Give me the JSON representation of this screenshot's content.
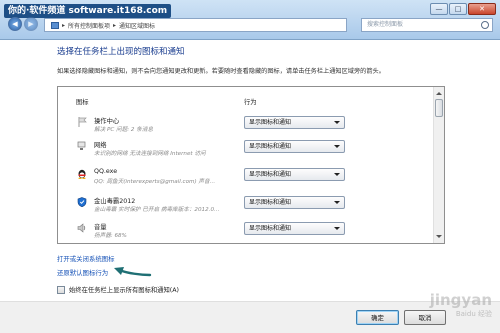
{
  "watermark": {
    "text": "你的·软件频道 software.it168.com"
  },
  "window": {
    "min_label": "—",
    "max_label": "□",
    "close_label": "✕"
  },
  "address": {
    "segments": [
      "所有控制面板项",
      "通知区域图标"
    ]
  },
  "search": {
    "placeholder": "搜索控制面板"
  },
  "page": {
    "title": "选择在任务栏上出现的图标和通知",
    "description": "如果选择隐藏图标和通知，则不会向您通知更改和更新。若要随时查看隐藏的图标，请单击任务栏上通知区域旁的箭头。"
  },
  "list": {
    "col_icon": "图标",
    "col_behavior": "行为",
    "rows": [
      {
        "name": "操作中心",
        "sub": "解决 PC 问题: 2 条消息",
        "behavior": "显示图标和通知",
        "icon": "flag-icon"
      },
      {
        "name": "网络",
        "sub": "未识别的网络 无法连接到网络 Internet 访问",
        "behavior": "显示图标和通知",
        "icon": "network-icon"
      },
      {
        "name": "QQ.exe",
        "sub": "QQ: 周鱼天(interexperts@gmail.com) 声音…",
        "behavior": "显示图标和通知",
        "icon": "qq-icon"
      },
      {
        "name": "金山毒霸2012",
        "sub": "金山毒霸 实时保护 已开启 病毒库版本：2012.0…",
        "behavior": "显示图标和通知",
        "icon": "shield-icon"
      },
      {
        "name": "音量",
        "sub": "扬声器: 68%",
        "behavior": "显示图标和通知",
        "icon": "volume-icon"
      }
    ]
  },
  "links": {
    "system_icons": "打开或关闭系统图标",
    "restore": "还原默认图标行为"
  },
  "checkbox": {
    "label": "始终在任务栏上显示所有图标和通知(A)"
  },
  "buttons": {
    "ok": "确定",
    "cancel": "取消"
  },
  "sitemark": {
    "big": "jingyan",
    "small": "Baidu 经验"
  },
  "colors": {
    "link": "#1a55b8",
    "title": "#1a3d8f",
    "arrow": "#1f6f74"
  }
}
